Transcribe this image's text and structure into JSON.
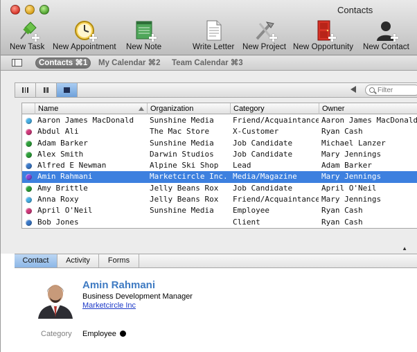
{
  "window": {
    "title": "Contacts"
  },
  "toolbar": [
    {
      "id": "new-task",
      "label": "New Task",
      "icon": "pushpin-icon"
    },
    {
      "id": "new-appointment",
      "label": "New Appointment",
      "icon": "clock-icon"
    },
    {
      "id": "new-note",
      "label": "New Note",
      "icon": "note-pad-icon"
    },
    {
      "id": "write-letter",
      "label": "Write Letter",
      "icon": "document-icon"
    },
    {
      "id": "new-project",
      "label": "New Project",
      "icon": "tools-icon"
    },
    {
      "id": "new-opportunity",
      "label": "New Opportunity",
      "icon": "door-icon"
    },
    {
      "id": "new-contact",
      "label": "New Contact",
      "icon": "person-icon"
    }
  ],
  "tabs": [
    {
      "label": "Contacts ⌘1",
      "active": true
    },
    {
      "label": "My Calendar ⌘2",
      "active": false
    },
    {
      "label": "Team Calendar ⌘3",
      "active": false
    }
  ],
  "search": {
    "placeholder": "Filter"
  },
  "table": {
    "columns": [
      "Name",
      "Organization",
      "Category",
      "Owner"
    ],
    "rows": [
      {
        "dot": "#49b1e6",
        "name": "Aaron James MacDonald",
        "org": "Sunshine Media",
        "category": "Friend/Acquaintance",
        "owner": "Aaron James MacDonald"
      },
      {
        "dot": "#d23a7c",
        "name": "Abdul Ali",
        "org": "The Mac Store",
        "category": "X-Customer",
        "owner": "Ryan Cash"
      },
      {
        "dot": "#2ea13a",
        "name": "Adam Barker",
        "org": "Sunshine Media",
        "category": "Job Candidate",
        "owner": "Michael Lanzer"
      },
      {
        "dot": "#2ea13a",
        "name": "Alex  Smith",
        "org": "Darwin Studios",
        "category": "Job Candidate",
        "owner": "Mary Jennings"
      },
      {
        "dot": "#3a79c9",
        "name": "Alfred E Newman",
        "org": "Alpine Ski Shop",
        "category": "Lead",
        "owner": "Adam Barker"
      },
      {
        "dot": "#8b45d8",
        "name": "Amin Rahmani",
        "org": "Marketcircle Inc.",
        "category": "Media/Magazine",
        "owner": "Mary Jennings",
        "selected": true
      },
      {
        "dot": "#2ea13a",
        "name": "Amy Brittle",
        "org": "Jelly Beans Rox",
        "category": "Job Candidate",
        "owner": "April O'Neil"
      },
      {
        "dot": "#49b1e6",
        "name": "Anna Roxy",
        "org": "Jelly Beans Rox",
        "category": "Friend/Acquaintance",
        "owner": "Mary Jennings"
      },
      {
        "dot": "#d23a7c",
        "name": "April O'Neil",
        "org": "Sunshine Media",
        "category": "Employee",
        "owner": "Ryan Cash"
      },
      {
        "dot": "#3a79c9",
        "name": "Bob Jones",
        "org": "",
        "category": "Client",
        "owner": "Ryan Cash"
      }
    ]
  },
  "detail_tabs": [
    {
      "label": "Contact",
      "active": true
    },
    {
      "label": "Activity",
      "active": false
    },
    {
      "label": "Forms",
      "active": false
    }
  ],
  "contact": {
    "name": "Amin Rahmani",
    "title": "Business Development Manager",
    "organization": "Marketcircle Inc",
    "category_label": "Category",
    "category_value": "Employee"
  }
}
